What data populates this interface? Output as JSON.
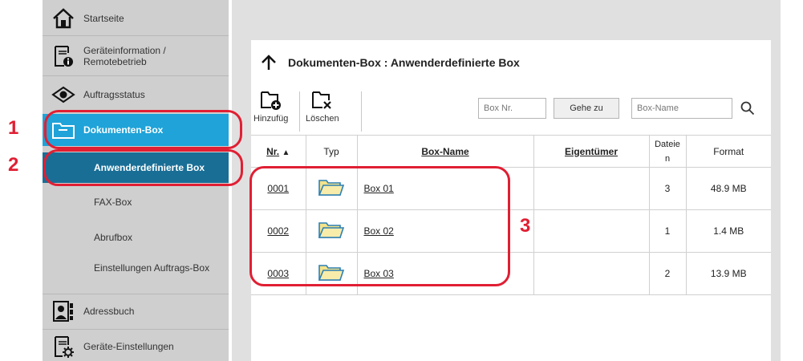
{
  "sidebar": {
    "items": [
      {
        "label": "Startseite",
        "icon": "home-icon"
      },
      {
        "label": "Geräteinformation / Remotebetrieb",
        "icon": "device-info-icon"
      },
      {
        "label": "Auftragsstatus",
        "icon": "eye-icon"
      },
      {
        "label": "Dokumenten-Box",
        "icon": "folder-icon"
      },
      {
        "label": "Adressbuch",
        "icon": "address-book-icon"
      },
      {
        "label": "Geräte-Einstellungen",
        "icon": "device-settings-icon"
      }
    ],
    "subitems": [
      {
        "label": "Anwenderdefinierte Box"
      },
      {
        "label": "FAX-Box"
      },
      {
        "label": "Abrufbox"
      },
      {
        "label": "Einstellungen Auftrags-Box"
      }
    ]
  },
  "callouts": {
    "one": "1",
    "two": "2",
    "three": "3"
  },
  "panel": {
    "title": "Dokumenten-Box : Anwenderdefinierte Box",
    "toolbar": {
      "add_label": "Hinzufüg",
      "delete_label": "Löschen",
      "box_nr_placeholder": "Box Nr.",
      "goto_label": "Gehe zu",
      "box_name_placeholder": "Box-Name"
    },
    "table": {
      "headers": {
        "nr": "Nr.",
        "sort": "▲",
        "typ": "Typ",
        "name": "Box-Name",
        "owner": "Eigentümer",
        "files": "Dateien",
        "format": "Format"
      },
      "rows": [
        {
          "nr": "0001",
          "name": "Box 01",
          "owner": "",
          "files": "3",
          "format": "48.9 MB"
        },
        {
          "nr": "0002",
          "name": "Box 02",
          "owner": "",
          "files": "1",
          "format": "1.4 MB"
        },
        {
          "nr": "0003",
          "name": "Box 03",
          "owner": "",
          "files": "2",
          "format": "13.9 MB"
        }
      ]
    }
  },
  "colors": {
    "accent_blue": "#1fa3d8",
    "dark_blue": "#196e96",
    "callout_red": "#e01f33",
    "folder_yellow": "#f3e38a"
  }
}
